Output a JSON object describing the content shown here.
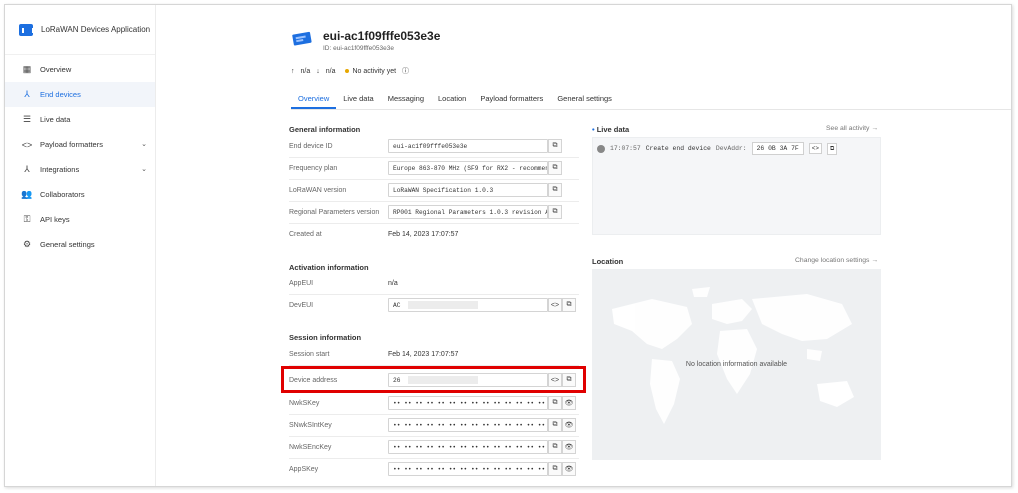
{
  "app": {
    "title": "LoRaWAN Devices Application"
  },
  "sidebar": {
    "items": [
      {
        "label": "Overview",
        "icon": "dashboard-icon"
      },
      {
        "label": "End devices",
        "icon": "network-icon",
        "active": true
      },
      {
        "label": "Live data",
        "icon": "list-icon"
      },
      {
        "label": "Payload formatters",
        "icon": "code-icon",
        "expand": true
      },
      {
        "label": "Integrations",
        "icon": "integrations-icon",
        "expand": true
      },
      {
        "label": "Collaborators",
        "icon": "people-icon"
      },
      {
        "label": "API keys",
        "icon": "key-icon"
      },
      {
        "label": "General settings",
        "icon": "gear-icon"
      }
    ]
  },
  "device": {
    "title": "eui-ac1f09fffe053e3e",
    "id_line": "ID: eui-ac1f09fffe053e3e",
    "up": "n/a",
    "down": "n/a",
    "activity": "No activity yet"
  },
  "tabs": [
    "Overview",
    "Live data",
    "Messaging",
    "Location",
    "Payload formatters",
    "General settings"
  ],
  "general": {
    "title": "General information",
    "rows": [
      {
        "label": "End device ID",
        "value": "eui-ac1f09fffe053e3e"
      },
      {
        "label": "Frequency plan",
        "value": "Europe 863-870 MHz (SF9 for RX2 - recommen…"
      },
      {
        "label": "LoRaWAN version",
        "value": "LoRaWAN Specification 1.0.3"
      },
      {
        "label": "Regional Parameters version",
        "value": "RP001 Regional Parameters 1.0.3 revision A"
      },
      {
        "label": "Created at",
        "value": "Feb 14, 2023 17:07:57"
      }
    ]
  },
  "activation": {
    "title": "Activation information",
    "app_eui_label": "AppEUI",
    "app_eui_value": "n/a",
    "dev_eui_label": "DevEUI",
    "dev_eui_value": "AC"
  },
  "session": {
    "title": "Session information",
    "start_label": "Session start",
    "start_value": "Feb 14, 2023 17:07:57",
    "devaddr_label": "Device address",
    "devaddr_value": "26",
    "keys": [
      {
        "label": "NwkSKey",
        "value": "•• •• •• •• •• •• •• •• •• •• •• •• •• •• •• ••"
      },
      {
        "label": "SNwkSIntKey",
        "value": "•• •• •• •• •• •• •• •• •• •• •• •• •• •• •• ••"
      },
      {
        "label": "NwkSEncKey",
        "value": "•• •• •• •• •• •• •• •• •• •• •• •• •• •• •• ••"
      },
      {
        "label": "AppSKey",
        "value": "•• •• •• •• •• •• •• •• •• •• •• •• •• •• •• ••"
      }
    ]
  },
  "live": {
    "title": "Live data",
    "link": "See all activity →",
    "time": "17:07:57",
    "event": "Create end device",
    "devaddr_label": "DevAddr:",
    "devaddr_value": "26 0B 3A 7F"
  },
  "location": {
    "title": "Location",
    "link": "Change location settings →",
    "empty": "No location information available"
  },
  "colors": {
    "accent": "#1d6fe0",
    "highlight": "#e00000"
  }
}
